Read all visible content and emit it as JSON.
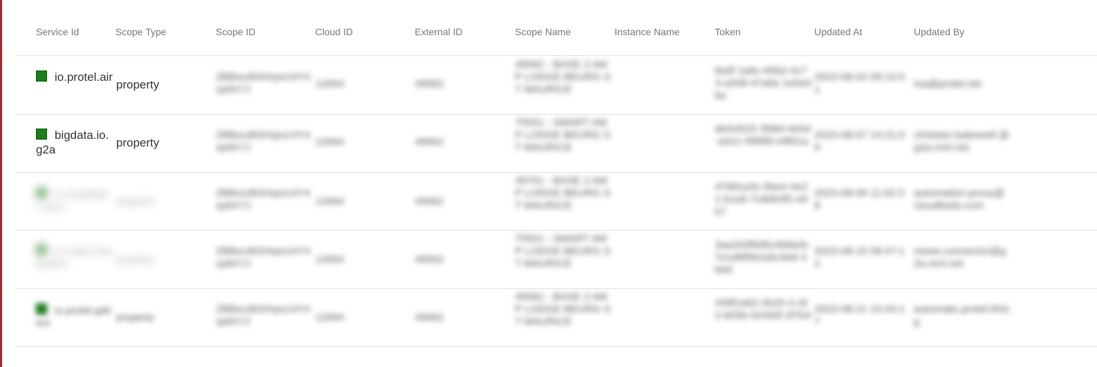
{
  "columns": [
    "Service Id",
    "Scope Type",
    "Scope ID",
    "Cloud ID",
    "External ID",
    "Scope Name",
    "Instance Name",
    "Token",
    "Updated At",
    "Updated By"
  ],
  "rows": [
    {
      "service_id": "io.protel.air",
      "scope_type": "property",
      "scope_id": "ZBBxcd92Hrpo14Y4zp6X7J",
      "cloud_id": "12064",
      "external_id": "49062",
      "scope_name": "49062 - BASE 2 AMP LODGE BEURG ST MAURICE",
      "token": "8a3f 1a6c-65b2-4c73-a348-47a6e 1e0e9be",
      "updated_at": "2023-08-02 09:14:51",
      "updated_by": "ina@protel.net",
      "status": "green"
    },
    {
      "service_id": "bigdata.io.g2a",
      "scope_type": "property",
      "scope_id": "ZBBxcd92Hrpo14Y4zp6X7J",
      "cloud_id": "12064",
      "external_id": "49062",
      "scope_name": "75501 - SMART AMP LODGE BEURG ST MAURICE",
      "token": "ab4c81f1-5b8d-4e5d-a2e1-5f86fd e9f01a",
      "updated_at": "2023-08-07 14:21:09",
      "updated_by": "christian.bakewell @g2a.mrrl.net",
      "status": "green"
    },
    {
      "service_id": "io.cloudbeds.sync",
      "scope_type": "property",
      "scope_id": "ZBBxcd92Hrpo14Y4zp6X7J",
      "cloud_id": "12064",
      "external_id": "49062",
      "scope_name": "49701 - BASE 2 AMP LODGE BEURG ST MAURICE",
      "token": "47681a3c-0be4-4e2 1-b1a5-7c8d03f2 e9b7",
      "updated_at": "2023-08-09 11:02:38",
      "updated_by": "automation-proxy@ cloudbeds.com",
      "status": "green"
    },
    {
      "service_id": "io.mews.integration",
      "scope_type": "property",
      "scope_id": "ZBBxcd92Hrpo14Y4zp6X7J",
      "cloud_id": "12064",
      "external_id": "49062",
      "scope_name": "75501 - SMART AMP LODGE BEURG ST MAURICE",
      "token": "3aa1b0f6d5c4b8a3c7e1d6f0b2a5c9e8 4b6d",
      "updated_at": "2023-08-15 08:47:12",
      "updated_by": "mews.connector@g2a.mrrl.net",
      "status": "green"
    },
    {
      "service_id": "io.protel.gdirect",
      "scope_type": "property",
      "scope_id": "ZBBxcd92Hrpo14Y4zp6X7J",
      "cloud_id": "12064",
      "external_id": "49062",
      "scope_name": "49062 - BASE 2 AMP LODGE BEURG ST MAURICE",
      "token": "439f1a62-2b25-4 c62-825b-52450f 2f7b4",
      "updated_at": "2023-08-21 15:44:17",
      "updated_by": "automatic.protel-ifclog",
      "status": "green"
    }
  ]
}
